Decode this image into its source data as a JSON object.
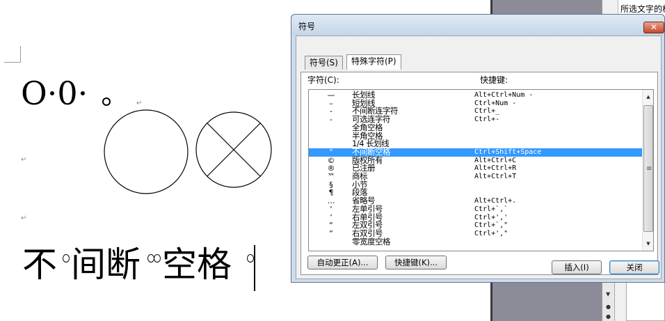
{
  "document": {
    "top_text": "O·0·",
    "small_circle_mark": "。",
    "bottom_text_parts": [
      "不",
      "间断",
      "空格"
    ],
    "paragraph_mark": "↵"
  },
  "dialog": {
    "title": "符号",
    "close_label": "✕",
    "tabs": [
      {
        "label": "符号(S)",
        "active": false
      },
      {
        "label": "特殊字符(P)",
        "active": true
      }
    ],
    "char_column_label": "字符(C):",
    "shortcut_column_label": "快捷键:",
    "rows": [
      {
        "sym": "—",
        "name": "长划线",
        "key": "Alt+Ctrl+Num -"
      },
      {
        "sym": "–",
        "name": "短划线",
        "key": "Ctrl+Num -"
      },
      {
        "sym": "‑",
        "name": "不间断连字符",
        "key": "Ctrl+_"
      },
      {
        "sym": "-",
        "name": "可选连字符",
        "key": "Ctrl+-"
      },
      {
        "sym": "",
        "name": "全角空格",
        "key": ""
      },
      {
        "sym": "",
        "name": "半角空格",
        "key": ""
      },
      {
        "sym": "",
        "name": "1/4 长划线",
        "key": ""
      },
      {
        "sym": "°",
        "name": "不间断空格",
        "key": "Ctrl+Shift+Space",
        "selected": true
      },
      {
        "sym": "©",
        "name": "版权所有",
        "key": "Alt+Ctrl+C"
      },
      {
        "sym": "®",
        "name": "已注册",
        "key": "Alt+Ctrl+R"
      },
      {
        "sym": "™",
        "name": "商标",
        "key": "Alt+Ctrl+T"
      },
      {
        "sym": "§",
        "name": "小节",
        "key": ""
      },
      {
        "sym": "¶",
        "name": "段落",
        "key": ""
      },
      {
        "sym": "…",
        "name": "省略号",
        "key": "Alt+Ctrl+."
      },
      {
        "sym": "‘",
        "name": "左单引号",
        "key": "Ctrl+`,`"
      },
      {
        "sym": "’",
        "name": "右单引号",
        "key": "Ctrl+','"
      },
      {
        "sym": "“",
        "name": "左双引号",
        "key": "Ctrl+`,\""
      },
      {
        "sym": "”",
        "name": "右双引号",
        "key": "Ctrl+',\""
      },
      {
        "sym": "",
        "name": "零宽度空格",
        "key": ""
      }
    ],
    "autocorrect_label": "自动更正(A)...",
    "shortcut_key_label": "快捷键(K)...",
    "insert_label": "插入(I)",
    "close_button_label": "关闭"
  },
  "task_pane": {
    "text": "所选文字的格"
  },
  "colors": {
    "selection": "#3399ff",
    "dialog_frame": "#cfdce9",
    "sidebar_gray": "#8c8c99"
  }
}
